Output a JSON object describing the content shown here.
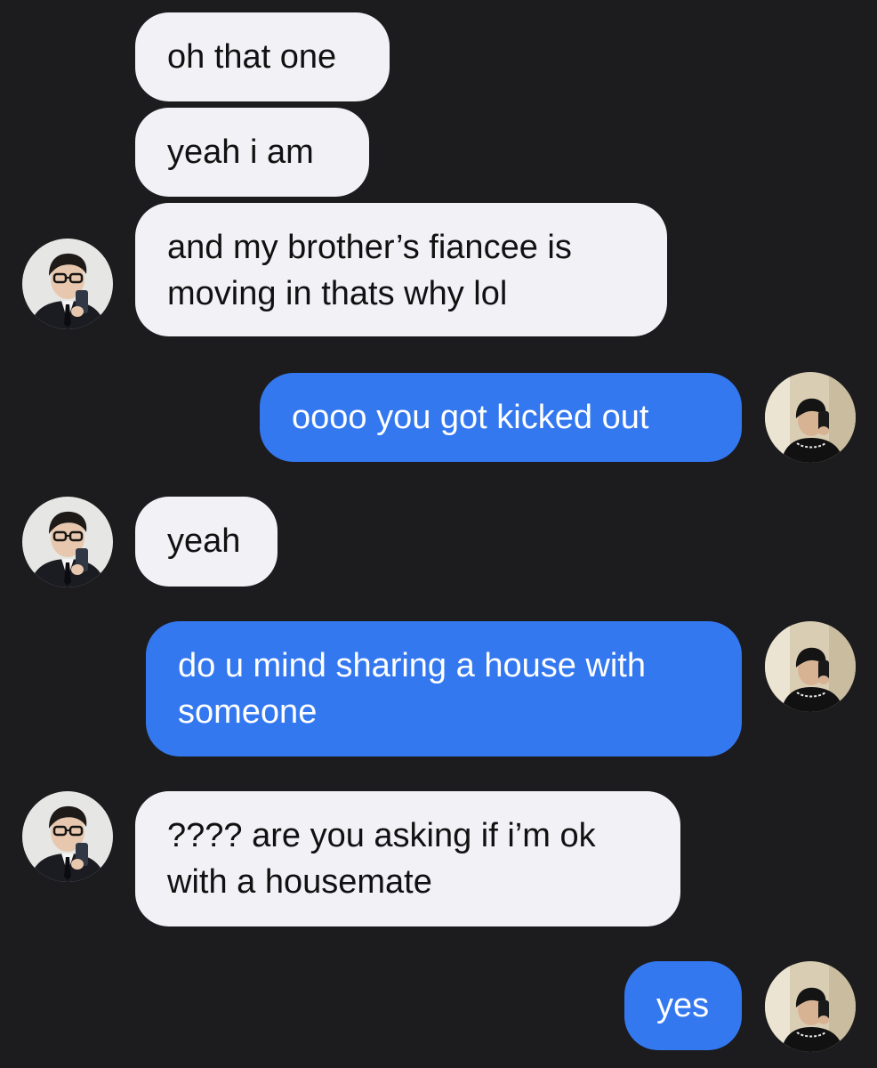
{
  "conversation": {
    "colors": {
      "background": "#1c1c1e",
      "incoming_bubble": "#f1f1f6",
      "outgoing_bubble": "#3478f0",
      "incoming_text": "#111111",
      "outgoing_text": "#ffffff"
    },
    "messages": [
      {
        "sender": "other",
        "text": "oh that one"
      },
      {
        "sender": "other",
        "text": "yeah i am"
      },
      {
        "sender": "other",
        "text": "and my brother’s fiancee is\nmoving in thats why lol"
      },
      {
        "sender": "me",
        "text": "oooo you got kicked out"
      },
      {
        "sender": "other",
        "text": "yeah"
      },
      {
        "sender": "me",
        "text": "do u mind sharing a house with\nsomeone"
      },
      {
        "sender": "other",
        "text": "???? are you asking if i’m ok\nwith a housemate"
      },
      {
        "sender": "me",
        "text": "yes"
      }
    ],
    "avatars": {
      "other": "contact-avatar-glasses-suit",
      "me": "user-avatar-mirror-selfie"
    }
  }
}
